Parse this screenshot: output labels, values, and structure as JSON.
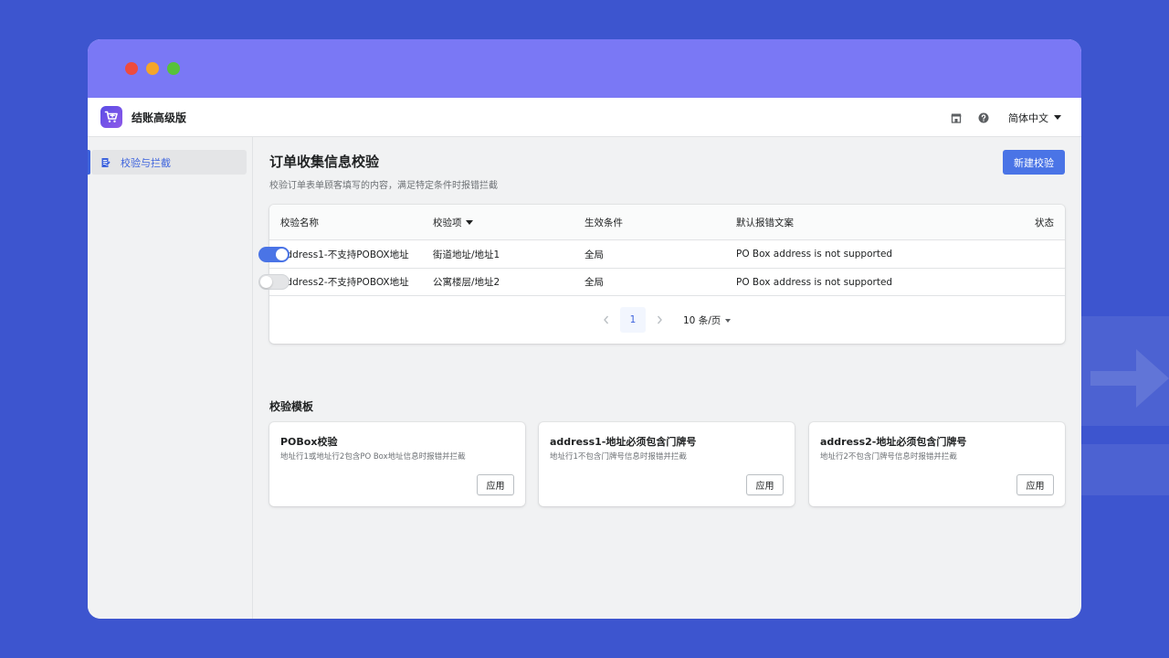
{
  "app": {
    "name": "结账高级版",
    "language": "简体中文"
  },
  "sidebar": {
    "items": [
      {
        "label": "校验与拦截",
        "active": true
      }
    ]
  },
  "page": {
    "title": "订单收集信息校验",
    "subtitle": "校验订单表单顾客填写的内容，满足特定条件时报错拦截",
    "new_button": "新建校验"
  },
  "table": {
    "headers": [
      "校验名称",
      "校验项",
      "生效条件",
      "默认报错文案",
      "状态"
    ],
    "rows": [
      {
        "name": "address1-不支持POBOX地址",
        "field": "街道地址/地址1",
        "condition": "全局",
        "message": "PO Box address is not supported",
        "enabled": true
      },
      {
        "name": "address2-不支持POBOX地址",
        "field": "公寓楼层/地址2",
        "condition": "全局",
        "message": "PO Box address is not supported",
        "enabled": false
      }
    ],
    "pagination": {
      "current_page": "1",
      "page_size": "10 条/页"
    }
  },
  "templates": {
    "title": "校验模板",
    "items": [
      {
        "name": "POBox校验",
        "desc": "地址行1或地址行2包含PO Box地址信息时报错并拦截",
        "apply": "应用"
      },
      {
        "name": "address1-地址必须包含门牌号",
        "desc": "地址行1不包含门牌号信息时报错并拦截",
        "apply": "应用"
      },
      {
        "name": "address2-地址必须包含门牌号",
        "desc": "地址行2不包含门牌号信息时报错并拦截",
        "apply": "应用"
      }
    ]
  },
  "colors": {
    "background": "#3d55cf",
    "titlebar": "#7a78f5",
    "accent": "#4a74e6"
  }
}
